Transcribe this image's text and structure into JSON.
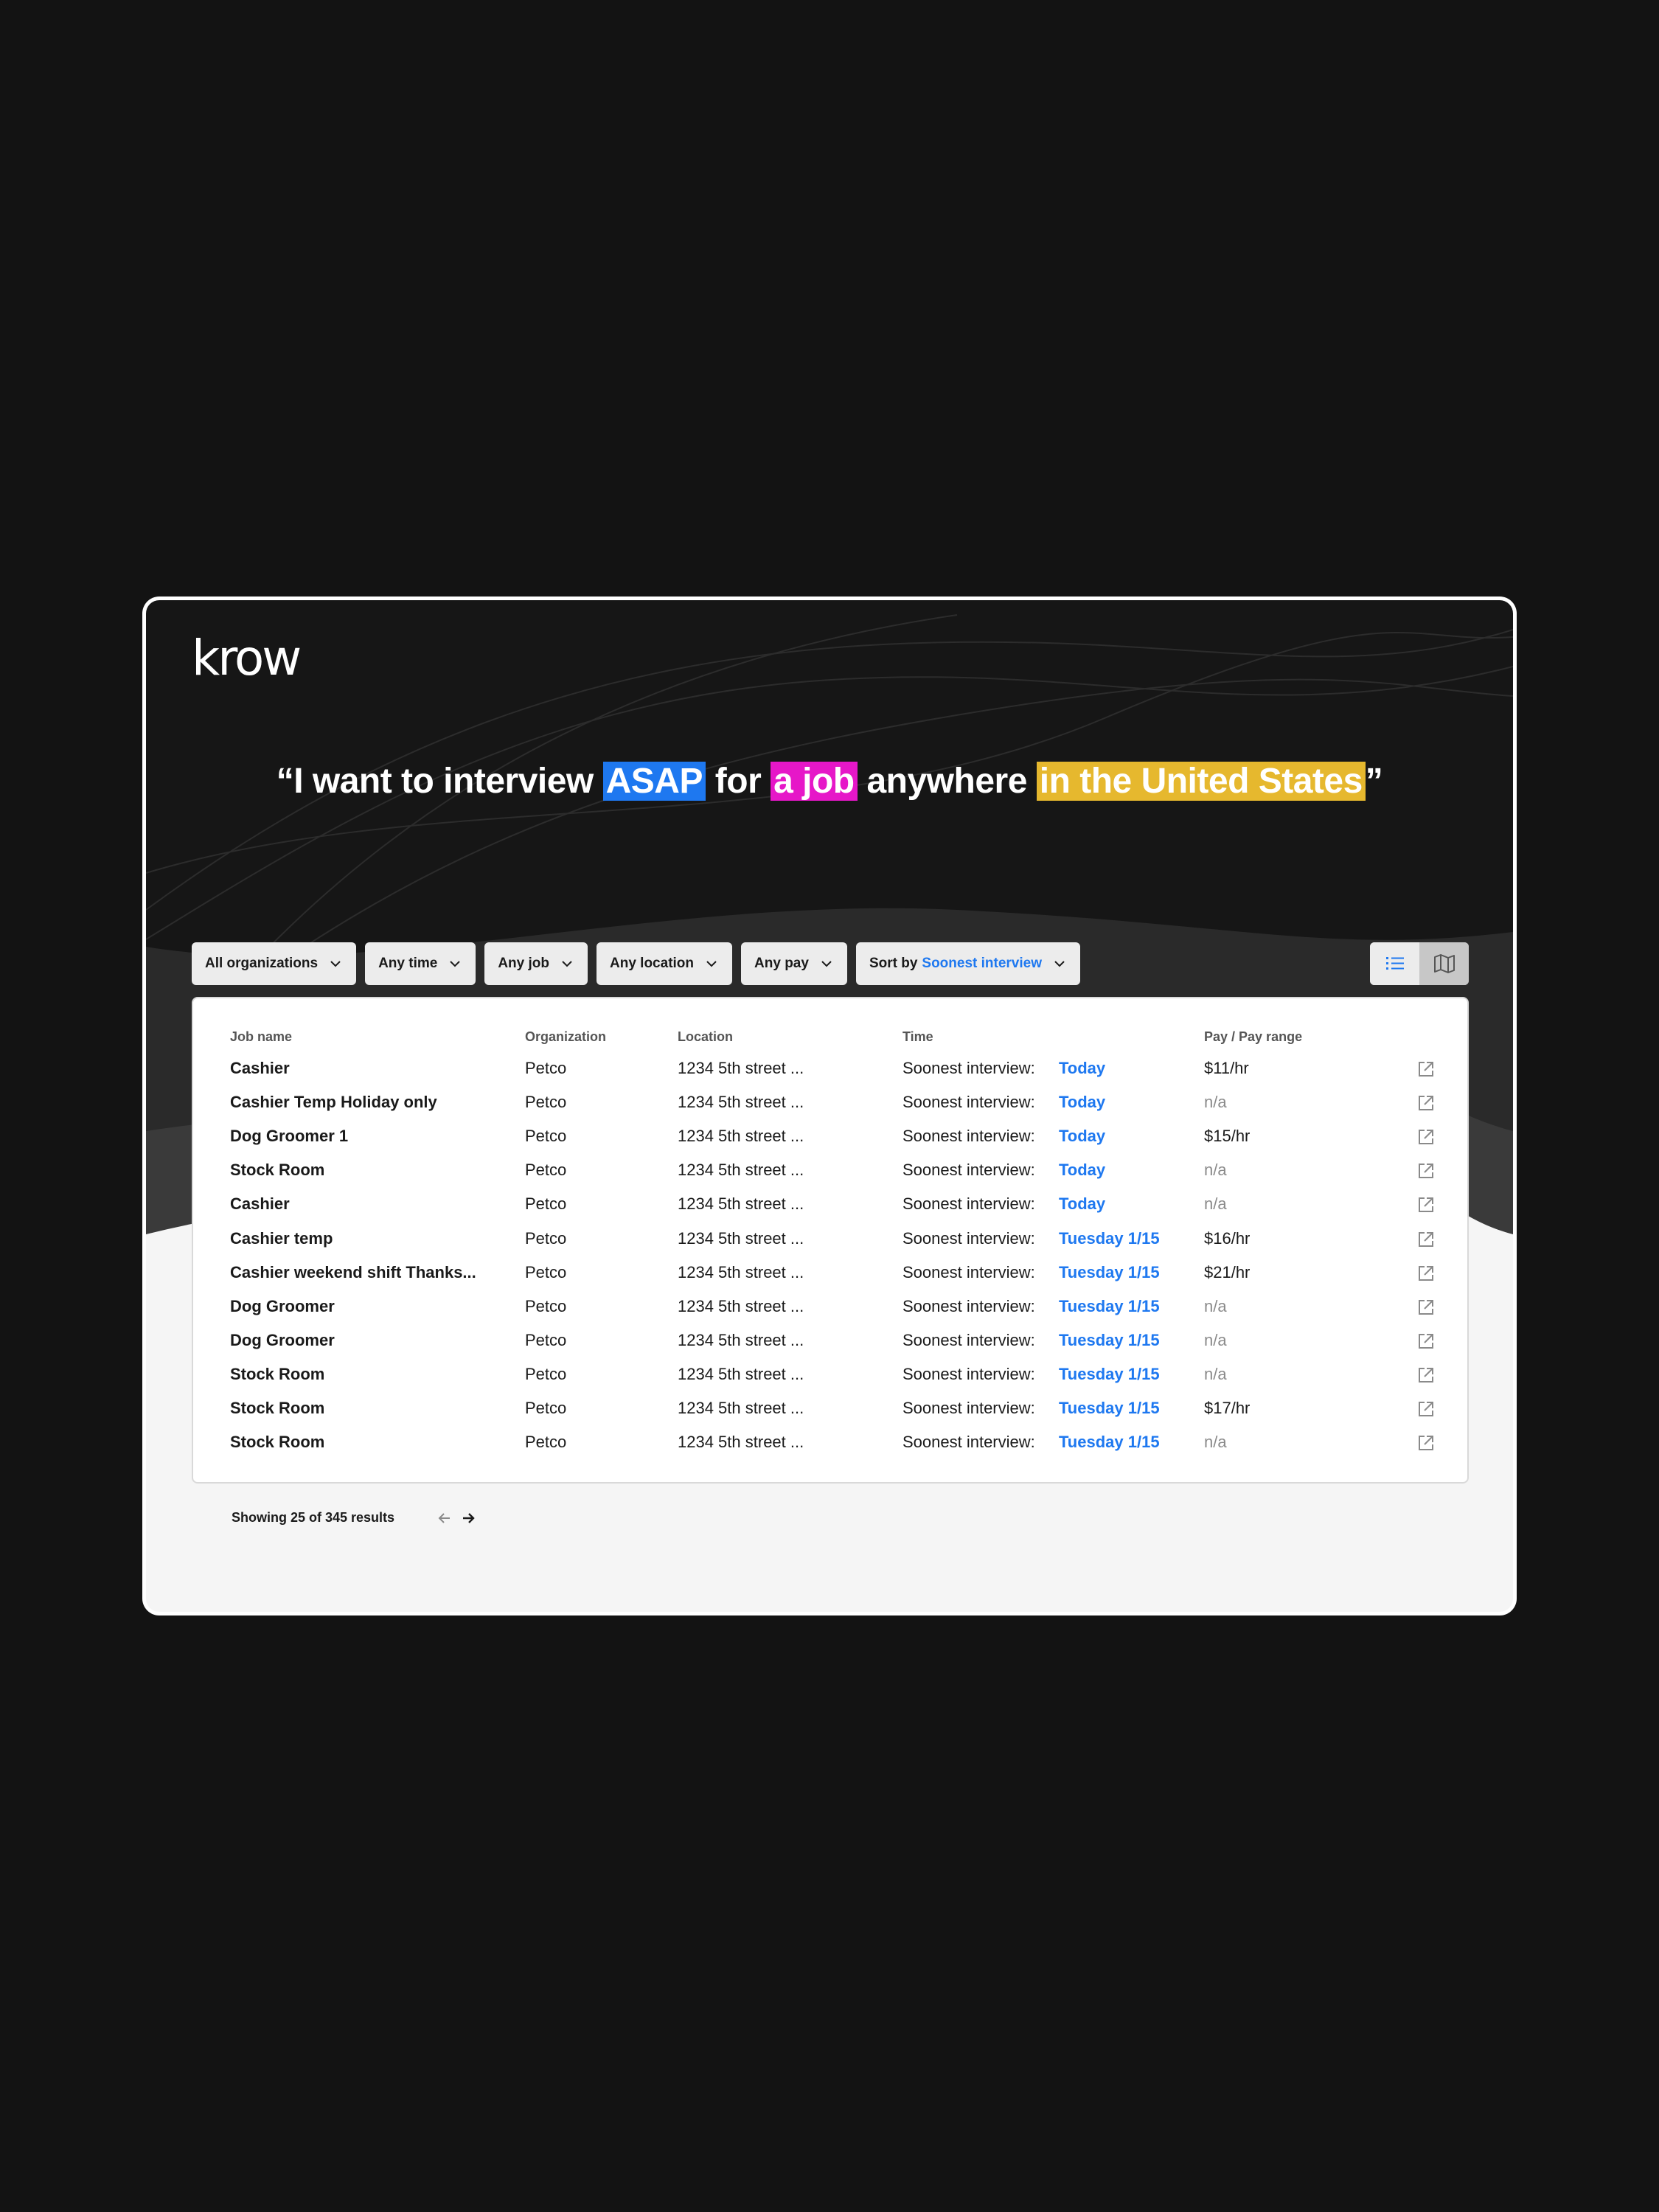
{
  "brand": {
    "logo": "krow"
  },
  "headline": {
    "open_quote": "“",
    "part1": "I want to interview ",
    "hl1": "ASAP",
    "part2": " for ",
    "hl2": "a job",
    "part3": " anywhere ",
    "hl3": "in the United States",
    "close_quote": "”",
    "colors": {
      "hl1": "#1e78f0",
      "hl2": "#e617c8",
      "hl3": "#e6b82e"
    }
  },
  "filters": {
    "organization": "All organizations",
    "time": "Any time",
    "job": "Any job",
    "location": "Any location",
    "pay": "Any pay",
    "sort_prefix": "Sort by",
    "sort_value": "Soonest interview"
  },
  "view_toggle": {
    "list_icon": "list-icon",
    "map_icon": "map-icon",
    "active": "list"
  },
  "table": {
    "headers": {
      "job": "Job name",
      "org": "Organization",
      "loc": "Location",
      "time": "Time",
      "pay": "Pay / Pay range"
    },
    "rows": [
      {
        "job": "Cashier",
        "org": "Petco",
        "loc": "1234 5th street ...",
        "time_label": "Soonest interview:",
        "time_value": "Today",
        "pay": "$11/hr"
      },
      {
        "job": "Cashier Temp Holiday only",
        "org": "Petco",
        "loc": "1234 5th street ...",
        "time_label": "Soonest interview:",
        "time_value": "Today",
        "pay": "n/a"
      },
      {
        "job": "Dog Groomer 1",
        "org": "Petco",
        "loc": "1234 5th street ...",
        "time_label": "Soonest interview:",
        "time_value": "Today",
        "pay": "$15/hr"
      },
      {
        "job": "Stock Room",
        "org": "Petco",
        "loc": "1234 5th street ...",
        "time_label": "Soonest interview:",
        "time_value": "Today",
        "pay": "n/a"
      },
      {
        "job": "Cashier",
        "org": "Petco",
        "loc": "1234 5th street ...",
        "time_label": "Soonest interview:",
        "time_value": "Today",
        "pay": "n/a"
      },
      {
        "job": "Cashier temp",
        "org": "Petco",
        "loc": "1234 5th street ...",
        "time_label": "Soonest interview:",
        "time_value": "Tuesday 1/15",
        "pay": "$16/hr"
      },
      {
        "job": "Cashier weekend shift Thanks...",
        "org": "Petco",
        "loc": "1234 5th street ...",
        "time_label": "Soonest interview:",
        "time_value": "Tuesday 1/15",
        "pay": "$21/hr"
      },
      {
        "job": "Dog Groomer",
        "org": "Petco",
        "loc": "1234 5th street ...",
        "time_label": "Soonest interview:",
        "time_value": "Tuesday 1/15",
        "pay": "n/a"
      },
      {
        "job": "Dog Groomer",
        "org": "Petco",
        "loc": "1234 5th street ...",
        "time_label": "Soonest interview:",
        "time_value": "Tuesday 1/15",
        "pay": "n/a"
      },
      {
        "job": "Stock Room",
        "org": "Petco",
        "loc": "1234 5th street ...",
        "time_label": "Soonest interview:",
        "time_value": "Tuesday 1/15",
        "pay": "n/a"
      },
      {
        "job": "Stock Room",
        "org": "Petco",
        "loc": "1234 5th street ...",
        "time_label": "Soonest interview:",
        "time_value": "Tuesday 1/15",
        "pay": "$17/hr"
      },
      {
        "job": "Stock Room",
        "org": "Petco",
        "loc": "1234 5th street ...",
        "time_label": "Soonest interview:",
        "time_value": "Tuesday 1/15",
        "pay": "n/a"
      }
    ]
  },
  "footer": {
    "results_text": "Showing 25 of 345 results"
  },
  "colors": {
    "accent": "#1e78f0",
    "page_bg": "#131313",
    "hero_bg": "#161616"
  }
}
